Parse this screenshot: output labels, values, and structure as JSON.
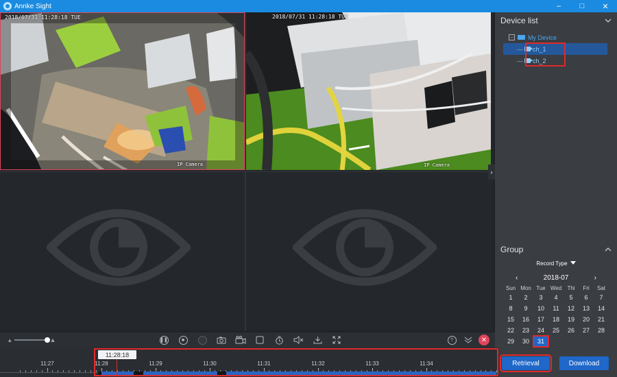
{
  "window": {
    "title": "Annke Sight",
    "minimize": "–",
    "maximize": "□",
    "close": "✕"
  },
  "video": {
    "cells": [
      {
        "osd_time": "2018/07/31 11:28:18 TUE",
        "osd_name": "IP Camera",
        "active": true
      },
      {
        "osd_time": "2018/07/31 11:28:18 TUE",
        "osd_name": "IP Camera",
        "active": false
      },
      {
        "placeholder_icon": "eye-icon"
      },
      {
        "placeholder_icon": "eye-icon"
      }
    ],
    "side_toggle": "›"
  },
  "device_list": {
    "title": "Device list",
    "collapse_icon": "chevron-down-icon",
    "root": {
      "expand": "−",
      "label": "My Device"
    },
    "channels": [
      {
        "label": "ch_1",
        "selected": true
      },
      {
        "label": "ch_2",
        "selected": false
      }
    ]
  },
  "group": {
    "title": "Group",
    "collapse_icon": "chevron-up-icon",
    "record_type_label": "Record Type",
    "calendar": {
      "month": "2018-07",
      "prev": "‹",
      "next": "›",
      "weekdays": [
        "Sun",
        "Mon",
        "Tue",
        "Wed",
        "Thi",
        "Fri",
        "Sat"
      ],
      "days": [
        [
          "1",
          "2",
          "3",
          "4",
          "5",
          "6",
          "7"
        ],
        [
          "8",
          "9",
          "10",
          "11",
          "12",
          "13",
          "14"
        ],
        [
          "15",
          "16",
          "17",
          "18",
          "19",
          "20",
          "21"
        ],
        [
          "22",
          "23",
          "24",
          "25",
          "26",
          "27",
          "28"
        ],
        [
          "29",
          "30",
          "31",
          "",
          "",
          "",
          ""
        ]
      ],
      "selected_day": "31"
    }
  },
  "actions": {
    "retrieval": "Retrieval",
    "download": "Download"
  },
  "toolbar": {
    "volume_level": 1.0,
    "mountain_small": "▴",
    "mountain_large": "▲",
    "icons": [
      "pause-icon",
      "stop-icon",
      "record-icon",
      "snapshot-icon",
      "clip-icon",
      "fullscreen-window-icon",
      "timer-icon",
      "mute-icon",
      "download-icon",
      "expand-icon"
    ],
    "help": "?",
    "fold": "»",
    "close": "✕"
  },
  "timeline": {
    "cursor_time": "11:28:18",
    "ticks": [
      "11:27",
      "11:28",
      "11:29",
      "11:30",
      "11:31",
      "11:32",
      "11:33",
      "11:34"
    ],
    "segments": [
      {
        "start": "11:27:56",
        "end": "11:28:00",
        "type": "gap"
      },
      {
        "start": "11:28:00",
        "end": "11:28:36",
        "type": "record"
      },
      {
        "start": "11:28:36",
        "end": "11:28:46",
        "type": "gap"
      },
      {
        "start": "11:28:46",
        "end": "11:30:08",
        "type": "record"
      },
      {
        "start": "11:30:08",
        "end": "11:30:18",
        "type": "gap"
      },
      {
        "start": "11:30:18",
        "end": "11:35:30",
        "type": "record"
      }
    ]
  },
  "colors": {
    "accent": "#1f67c8",
    "highlight_red": "#e02a2a",
    "titlebar": "#1a8be0"
  }
}
